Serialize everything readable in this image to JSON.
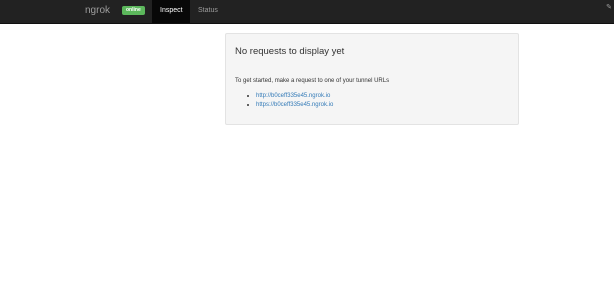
{
  "navbar": {
    "brand": "ngrok",
    "status_badge": "online",
    "tabs": [
      {
        "label": "Inspect",
        "active": true
      },
      {
        "label": "Status",
        "active": false
      }
    ],
    "corner_icon": "pin-icon"
  },
  "panel": {
    "title": "No requests to display yet",
    "intro": "To get started, make a request to one of your tunnel URLs",
    "urls": [
      "http://b0ceff335e45.ngrok.io",
      "https://b0ceff335e45.ngrok.io"
    ]
  },
  "colors": {
    "navbar_bg": "#222222",
    "active_tab_bg": "#080808",
    "badge_green": "#5cb85c",
    "link_blue": "#337ab7",
    "panel_bg": "#f5f5f5"
  }
}
